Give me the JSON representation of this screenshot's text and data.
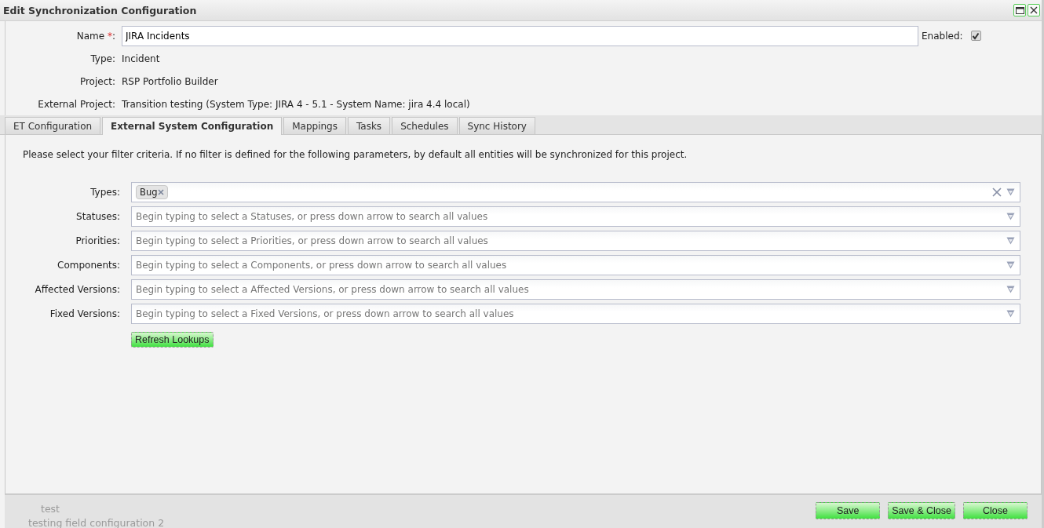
{
  "window": {
    "title": "Edit Synchronization Configuration"
  },
  "header": {
    "name_label": "Name",
    "required_mark": "*",
    "name_suffix": ":",
    "name_value": "JIRA Incidents",
    "enabled_label": "Enabled:",
    "enabled": true,
    "rows": [
      {
        "label": "Type:",
        "value": "Incident"
      },
      {
        "label": "Project:",
        "value": "RSP Portfolio Builder"
      },
      {
        "label": "External Project:",
        "value": "Transition testing (System Type: JIRA 4 - 5.1 - System Name: jira 4.4 local)"
      }
    ]
  },
  "tabs": [
    {
      "label": "ET Configuration",
      "selected": false
    },
    {
      "label": "External System Configuration",
      "selected": true
    },
    {
      "label": "Mappings",
      "selected": false
    },
    {
      "label": "Tasks",
      "selected": false
    },
    {
      "label": "Schedules",
      "selected": false
    },
    {
      "label": "Sync History",
      "selected": false
    }
  ],
  "intro": "Please select your filter criteria. If no filter is defined for the following parameters, by default all entities will be synchronized for this project.",
  "filters": [
    {
      "label": "Types:",
      "tags": [
        "Bug"
      ]
    },
    {
      "label": "Statuses:",
      "placeholder": "Begin typing to select a Statuses, or press down arrow to search all values"
    },
    {
      "label": "Priorities:",
      "placeholder": "Begin typing to select a Priorities, or press down arrow to search all values"
    },
    {
      "label": "Components:",
      "placeholder": "Begin typing to select a Components, or press down arrow to search all values"
    },
    {
      "label": "Affected Versions:",
      "placeholder": "Begin typing to select a Affected Versions, or press down arrow to search all values"
    },
    {
      "label": "Fixed Versions:",
      "placeholder": "Begin typing to select a Fixed Versions, or press down arrow to search all values"
    }
  ],
  "refresh_button": "Refresh Lookups",
  "background_items": [
    "test",
    "testing field configuration 2"
  ],
  "buttons": [
    "Save",
    "Save & Close",
    "Close"
  ]
}
